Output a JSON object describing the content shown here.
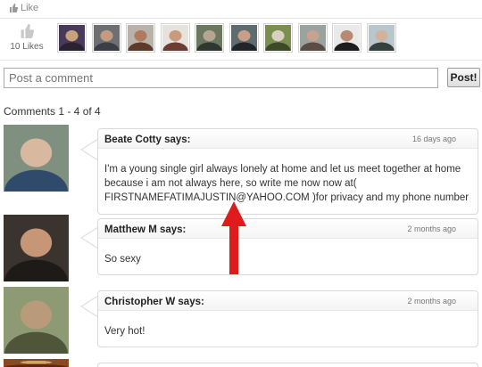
{
  "like_bar": {
    "label": "Like"
  },
  "likes": {
    "count_label": "10 Likes"
  },
  "likers": [
    {
      "name": "liker-1",
      "colors": [
        "#4a3a5a",
        "#c7a27a",
        "#2a2230"
      ]
    },
    {
      "name": "liker-2",
      "colors": [
        "#6d6f72",
        "#c69a80",
        "#3b3e46"
      ]
    },
    {
      "name": "liker-3",
      "colors": [
        "#b9b2a8",
        "#b07a5e",
        "#5c3b2a"
      ]
    },
    {
      "name": "liker-4",
      "colors": [
        "#e6e3df",
        "#c89a7e",
        "#6b3e35"
      ]
    },
    {
      "name": "liker-5",
      "colors": [
        "#6c7760",
        "#b7a593",
        "#2f3830"
      ]
    },
    {
      "name": "liker-6",
      "colors": [
        "#5e6c6f",
        "#c89f86",
        "#21252b"
      ]
    },
    {
      "name": "liker-7",
      "colors": [
        "#7b8f4e",
        "#d9d0c4",
        "#3d4a2a"
      ]
    },
    {
      "name": "liker-8",
      "colors": [
        "#9aa39d",
        "#c8a290",
        "#5b4c44"
      ]
    },
    {
      "name": "liker-9",
      "colors": [
        "#e9e9e9",
        "#b88a72",
        "#1d1d1f"
      ]
    },
    {
      "name": "liker-10",
      "colors": [
        "#b8c7cd",
        "#d3b29b",
        "#35413f"
      ]
    }
  ],
  "comment_form": {
    "placeholder": "Post a comment",
    "value": "",
    "post_label": "Post!"
  },
  "comments_header": {
    "range": "Comments 1 - 4 of 4"
  },
  "comments": [
    {
      "author": "Beate Cotty says:",
      "time": "16 days ago",
      "text": "I'm a young single girl always lonely at home and let us meet together at home because i am not always here, so write me now now at( FIRSTNAMEFATIMAJUSTIN@YAHOO.COM )for privacy and my phone number",
      "avatar_colors": [
        "#7f8f80",
        "#d8b9a0",
        "#2f4a6a"
      ]
    },
    {
      "author": "Matthew M says:",
      "time": "2 months ago",
      "text": "So sexy",
      "avatar_colors": [
        "#3b332e",
        "#c69677",
        "#1d1a18"
      ]
    },
    {
      "author": "Christopher W says:",
      "time": "2 months ago",
      "text": "Very hot!",
      "avatar_colors": [
        "#8d9a74",
        "#b99a7a",
        "#4f5538"
      ]
    },
    {
      "author": "",
      "time": "",
      "text": "",
      "avatar_colors": [
        "#8a4a1d",
        "#d9a45a",
        "#5a2a10"
      ]
    }
  ],
  "annotation": {
    "arrow_color": "#e01b1b"
  }
}
